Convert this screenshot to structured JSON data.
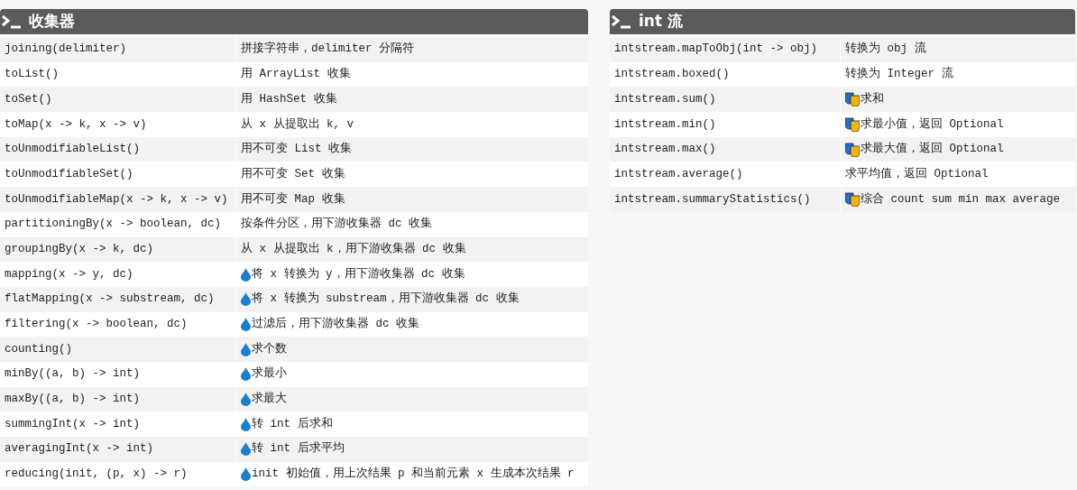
{
  "panels": [
    {
      "title": "收集器",
      "rows": [
        {
          "method": "joining(delimiter)",
          "description": "拼接字符串，delimiter 分隔符",
          "kind": "plain"
        },
        {
          "method": "toList()",
          "description": "用 ArrayList 收集",
          "kind": "plain"
        },
        {
          "method": "toSet()",
          "description": "用 HashSet 收集",
          "kind": "plain"
        },
        {
          "method": "toMap(x -> k, x -> v)",
          "description": "从 x 从提取出 k, v",
          "kind": "plain"
        },
        {
          "method": "toUnmodifiableList()",
          "description": "用不可变 List 收集",
          "kind": "plain"
        },
        {
          "method": "toUnmodifiableSet()",
          "description": "用不可变 Set 收集",
          "kind": "plain"
        },
        {
          "method": "toUnmodifiableMap(x -> k, x -> v)",
          "description": "用不可变 Map 收集",
          "kind": "plain"
        },
        {
          "method": "partitioningBy(x -> boolean, dc)",
          "description": "按条件分区，用下游收集器 dc 收集",
          "kind": "plain"
        },
        {
          "method": "groupingBy(x -> k, dc)",
          "description": "从 x 从提取出 k，用下游收集器 dc 收集",
          "kind": "plain"
        },
        {
          "method": "mapping(x -> y, dc)",
          "description": "将 x 转换为 y，用下游收集器 dc 收集",
          "kind": "drop"
        },
        {
          "method": "flatMapping(x -> substream, dc)",
          "description": "将 x 转换为 substream，用下游收集器 dc 收集",
          "kind": "drop"
        },
        {
          "method": "filtering(x -> boolean, dc)",
          "description": "过滤后，用下游收集器 dc 收集",
          "kind": "drop"
        },
        {
          "method": "counting()",
          "description": "求个数",
          "kind": "drop"
        },
        {
          "method": "minBy((a, b) -> int)",
          "description": "求最小",
          "kind": "drop"
        },
        {
          "method": "maxBy((a, b) -> int)",
          "description": "求最大",
          "kind": "drop"
        },
        {
          "method": "summingInt(x -> int)",
          "description": "转 int 后求和",
          "kind": "drop"
        },
        {
          "method": "averagingInt(x -> int)",
          "description": "转 int 后求平均",
          "kind": "drop"
        },
        {
          "method": "reducing(init, (p, x) -> r)",
          "description": "init 初始值，用上次结果 p 和当前元素 x 生成本次结果 r",
          "kind": "drop"
        }
      ]
    },
    {
      "title": "int 流",
      "rows": [
        {
          "method": "intstream.mapToObj(int -> obj)",
          "description": "转换为 obj 流",
          "kind": "plain"
        },
        {
          "method": "intstream.boxed()",
          "description": "转换为 Integer 流",
          "kind": "plain"
        },
        {
          "method": "intstream.sum()",
          "description": "求和",
          "kind": "masks"
        },
        {
          "method": "intstream.min()",
          "description": "求最小值，返回 Optional",
          "kind": "masks"
        },
        {
          "method": "intstream.max()",
          "description": "求最大值，返回 Optional",
          "kind": "masks"
        },
        {
          "method": "intstream.average()",
          "description": "求平均值，返回 Optional",
          "kind": "plain"
        },
        {
          "method": "intstream.summaryStatistics()",
          "description": "综合 count sum min max average",
          "kind": "masks"
        }
      ]
    }
  ]
}
